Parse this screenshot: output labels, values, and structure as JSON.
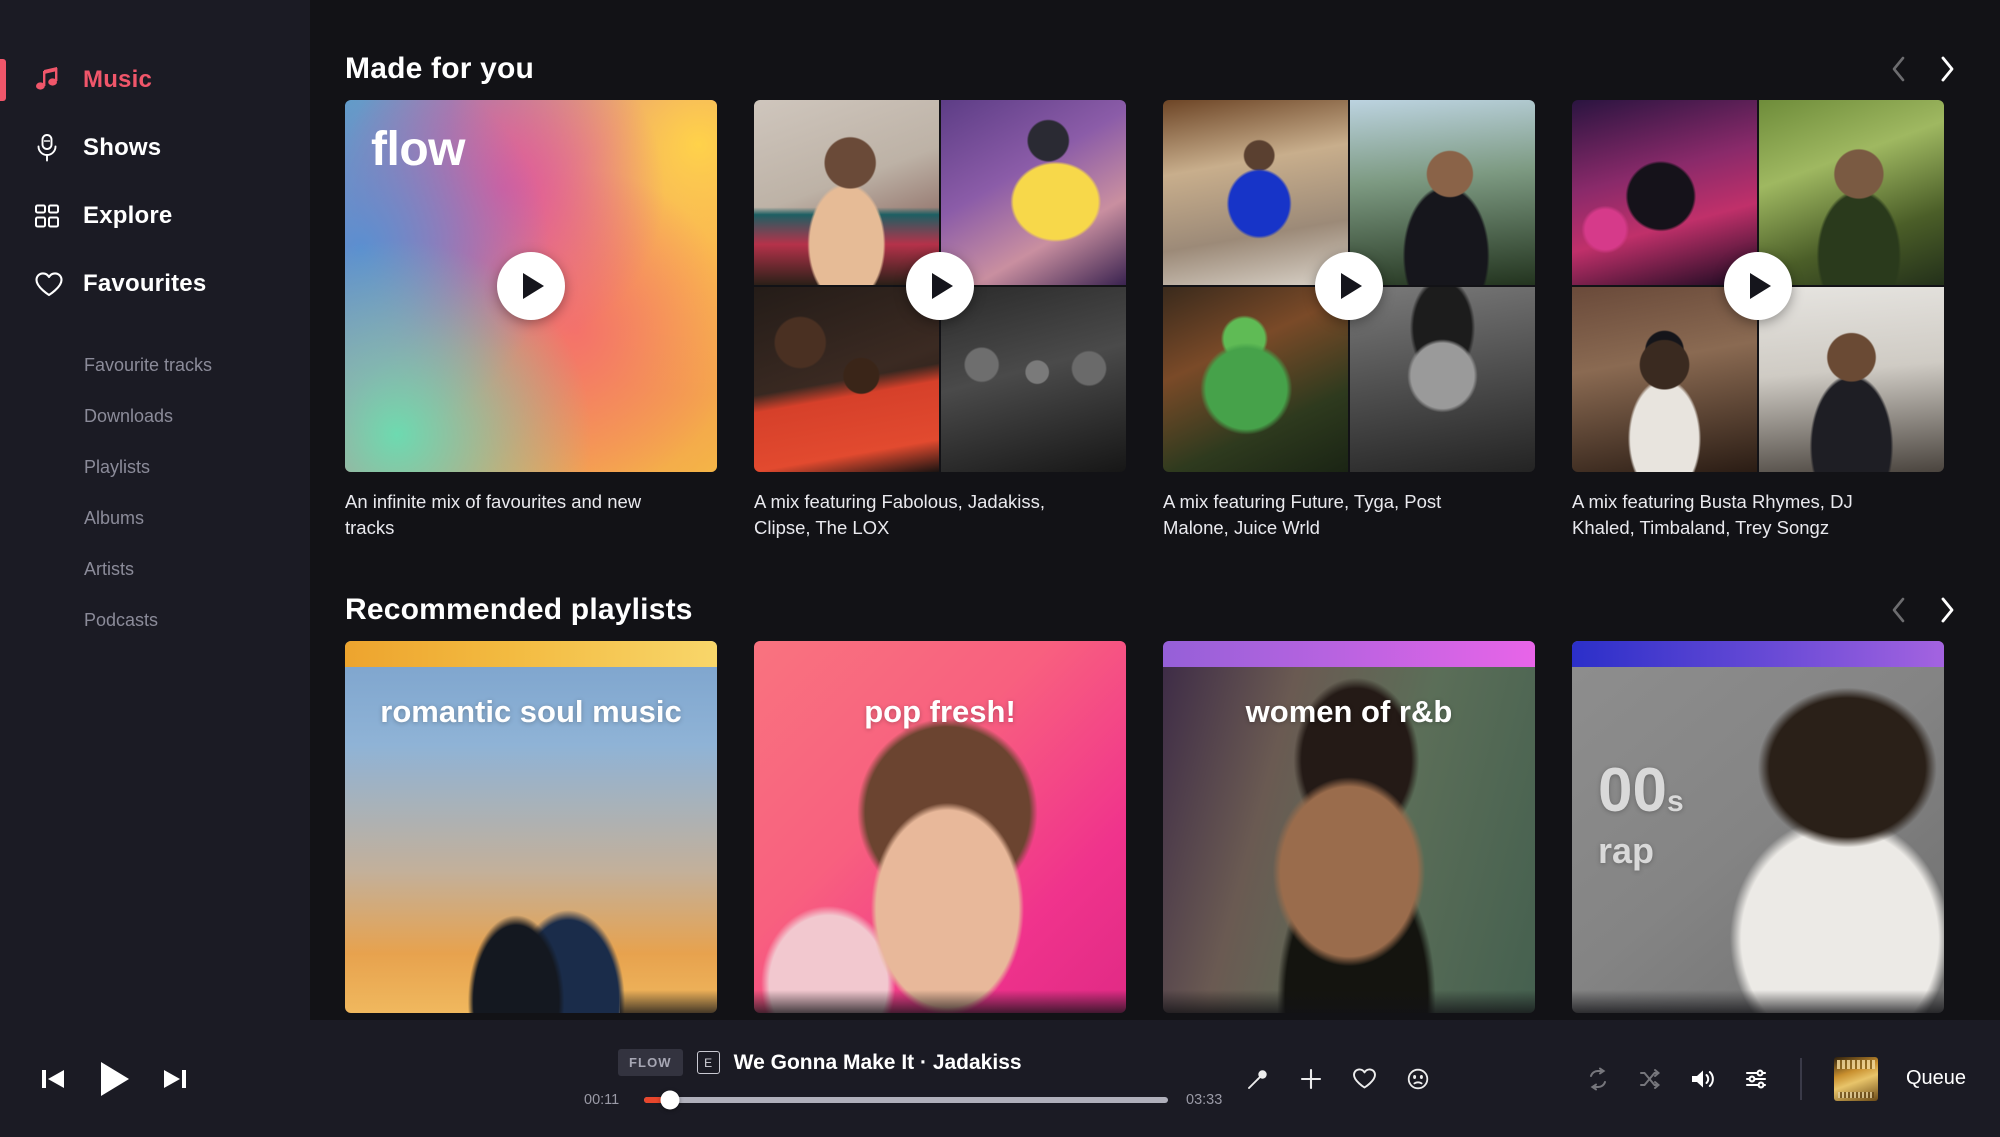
{
  "sidebar": {
    "main_items": [
      {
        "label": "Music",
        "icon": "music-note-icon",
        "active": true
      },
      {
        "label": "Shows",
        "icon": "microphone-icon",
        "active": false
      },
      {
        "label": "Explore",
        "icon": "grid-icon",
        "active": false
      },
      {
        "label": "Favourites",
        "icon": "heart-icon",
        "active": false
      }
    ],
    "sub_items": [
      {
        "label": "Favourite tracks"
      },
      {
        "label": "Downloads"
      },
      {
        "label": "Playlists"
      },
      {
        "label": "Albums"
      },
      {
        "label": "Artists"
      },
      {
        "label": "Podcasts"
      }
    ]
  },
  "sections": [
    {
      "title": "Made for you",
      "prev_enabled": false,
      "next_enabled": true,
      "cards": [
        {
          "kind": "flow",
          "badge_text": "flow",
          "caption": "An infinite mix of favourites and new tracks"
        },
        {
          "kind": "collage",
          "caption": "A mix featuring Fabolous, Jadakiss, Clipse, The LOX"
        },
        {
          "kind": "collage",
          "caption": "A mix featuring Future, Tyga, Post Malone, Juice Wrld"
        },
        {
          "kind": "collage",
          "caption": "A mix featuring Busta Rhymes, DJ Khaled, Timbaland, Trey Songz"
        }
      ]
    },
    {
      "title": "Recommended playlists",
      "prev_enabled": false,
      "next_enabled": true,
      "cards": [
        {
          "kind": "playlist",
          "title": "romantic soul music"
        },
        {
          "kind": "playlist",
          "title": "pop fresh!"
        },
        {
          "kind": "playlist",
          "title": "women of r&b"
        },
        {
          "kind": "playlist",
          "title_big": "00",
          "title_big_small": "s",
          "title_sub": "rap"
        }
      ]
    }
  ],
  "player": {
    "prev_icon": "skip-previous-icon",
    "play_icon": "play-icon",
    "next_icon": "skip-next-icon",
    "flow_badge": "FLOW",
    "explicit_badge": "E",
    "track": "We Gonna Make It · Jadakiss",
    "elapsed": "00:11",
    "duration": "03:33",
    "progress_percent": 5,
    "action_icons": [
      {
        "name": "lyrics-microphone-icon"
      },
      {
        "name": "add-to-playlist-icon"
      },
      {
        "name": "favourite-heart-icon"
      },
      {
        "name": "mood-face-icon"
      }
    ],
    "right_icons": [
      {
        "name": "repeat-icon",
        "dim": true
      },
      {
        "name": "shuffle-icon",
        "dim": true
      },
      {
        "name": "volume-icon",
        "dim": false
      },
      {
        "name": "equalizer-icon",
        "dim": false
      }
    ],
    "queue_label": "Queue"
  },
  "colors": {
    "accent": "#f0566a",
    "progress": "#e8462c",
    "sidebar_bg": "#1b1b24",
    "main_bg": "#121216"
  }
}
